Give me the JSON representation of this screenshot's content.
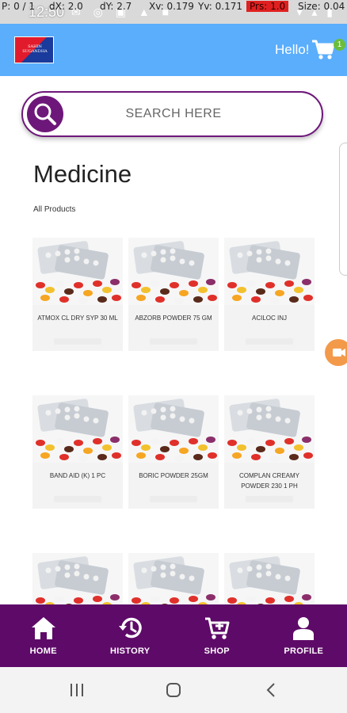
{
  "debug": {
    "pointer": "P: 0 / 1",
    "dx": "dX: 2.0",
    "dy": "dY: 2.7",
    "xv": "Xv: 0.179",
    "yv": "Yv: 0.171",
    "prs": "Prs: 1.0",
    "size": "Size: 0.04"
  },
  "status": {
    "time": "12:50"
  },
  "header": {
    "logo_text": "SAHIN SUGANDHA",
    "greeting": "Hello!",
    "cart_count": "1"
  },
  "search": {
    "placeholder": "SEARCH HERE"
  },
  "page": {
    "title": "Medicine",
    "subtitle": "All Products"
  },
  "products": [
    {
      "name": "ATMOX CL DRY SYP 30 ML"
    },
    {
      "name": "ABZORB POWDER 75 GM"
    },
    {
      "name": "ACILOC INJ"
    },
    {
      "name": "BAND AID (K) 1 pc"
    },
    {
      "name": "BORIC POWDER 25GM"
    },
    {
      "name": "COMPLAN CREAMY POWDER 230 1 PH"
    },
    {
      "name": ""
    },
    {
      "name": ""
    },
    {
      "name": ""
    }
  ],
  "nav": [
    {
      "label": "HOME",
      "icon": "home-icon"
    },
    {
      "label": "HISTORY",
      "icon": "history-icon"
    },
    {
      "label": "SHOP",
      "icon": "shop-cart-icon"
    },
    {
      "label": "PROFILE",
      "icon": "profile-icon"
    }
  ],
  "colors": {
    "header": "#5aaefc",
    "accent": "#6e177a",
    "nav": "#5e0a68",
    "badge": "#6bbd3c"
  }
}
